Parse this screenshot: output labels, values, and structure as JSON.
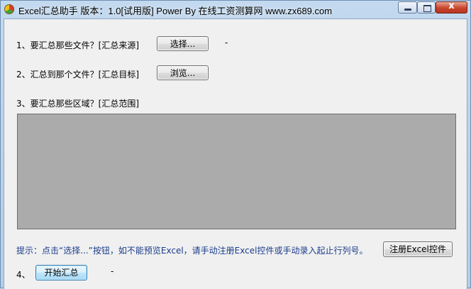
{
  "window": {
    "title": "Excel汇总助手 版本：1.0[试用版] Power By 在线工资测算网 www.zx689.com",
    "close_symbol": "x"
  },
  "step1": {
    "label": "1、要汇总那些文件？[汇总来源]",
    "button_label": "选择...",
    "status": "-"
  },
  "step2": {
    "label": "2、汇总到那个文件？[汇总目标]",
    "button_label": "浏览..."
  },
  "step3": {
    "label": "3、要汇总那些区域？[汇总范围]"
  },
  "hint": {
    "text": "提示：点击“选择...”按钮，如不能预览Excel，请手动注册Excel控件或手动录入起止行列号。",
    "register_button_label": "注册Excel控件"
  },
  "step4": {
    "label": "4、",
    "button_label": "开始汇总",
    "status": "-"
  },
  "colors": {
    "preview_background": "#ababab",
    "hint_text": "#1a3c8c",
    "window_frame": "#c3d9ef"
  },
  "icons": {
    "app": "excel-helper-app-icon",
    "minimize": "minimize-icon",
    "maximize": "maximize-icon",
    "close": "close-icon"
  }
}
